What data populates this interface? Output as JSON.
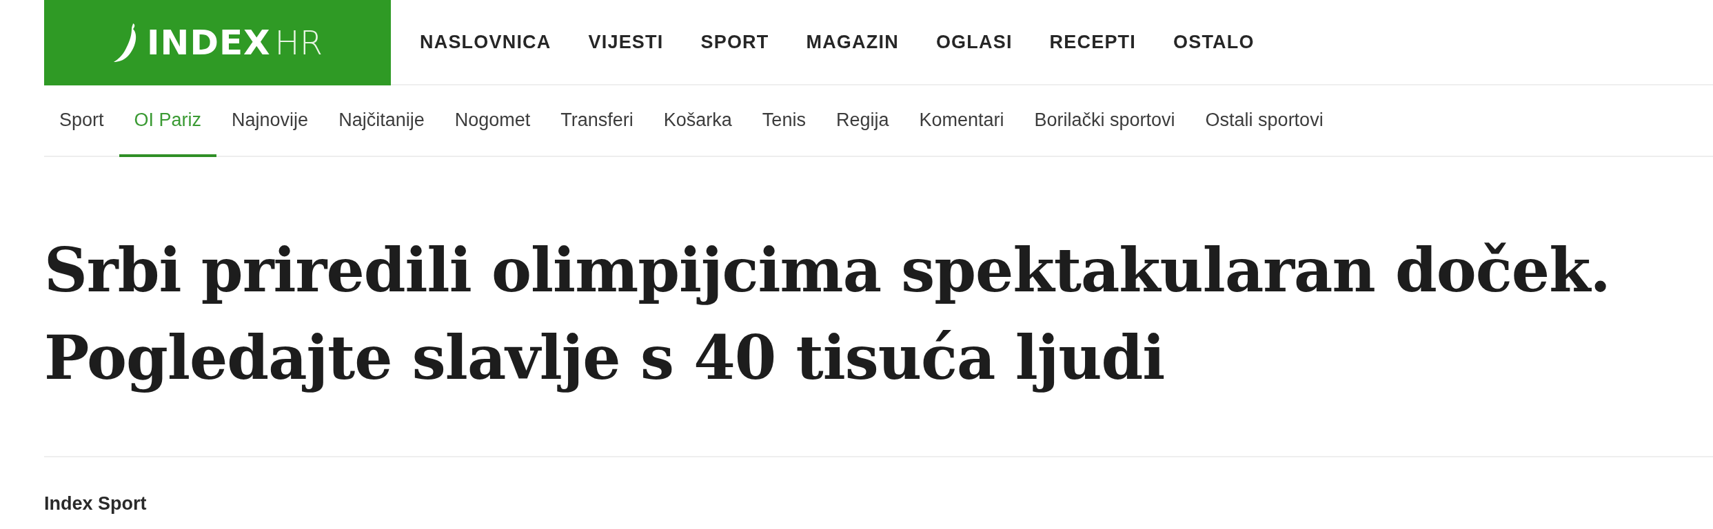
{
  "logo": {
    "name": "INDEX",
    "suffix": "HR"
  },
  "main_nav": [
    {
      "label": "NASLOVNICA"
    },
    {
      "label": "VIJESTI"
    },
    {
      "label": "SPORT"
    },
    {
      "label": "MAGAZIN"
    },
    {
      "label": "OGLASI"
    },
    {
      "label": "RECEPTI"
    },
    {
      "label": "OSTALO"
    }
  ],
  "sub_nav": [
    {
      "label": "Sport",
      "selected": false
    },
    {
      "label": "OI Pariz",
      "selected": true
    },
    {
      "label": "Najnovije",
      "selected": false
    },
    {
      "label": "Najčitanije",
      "selected": false
    },
    {
      "label": "Nogomet",
      "selected": false
    },
    {
      "label": "Transferi",
      "selected": false
    },
    {
      "label": "Košarka",
      "selected": false
    },
    {
      "label": "Tenis",
      "selected": false
    },
    {
      "label": "Regija",
      "selected": false
    },
    {
      "label": "Komentari",
      "selected": false
    },
    {
      "label": "Borilački sportovi",
      "selected": false
    },
    {
      "label": "Ostali sportovi",
      "selected": false
    }
  ],
  "article": {
    "headline": "Srbi priredili olimpijcima spektakularan doček. Pogledajte slavlje s 40 tisuća ljudi",
    "author": "Index Sport"
  }
}
